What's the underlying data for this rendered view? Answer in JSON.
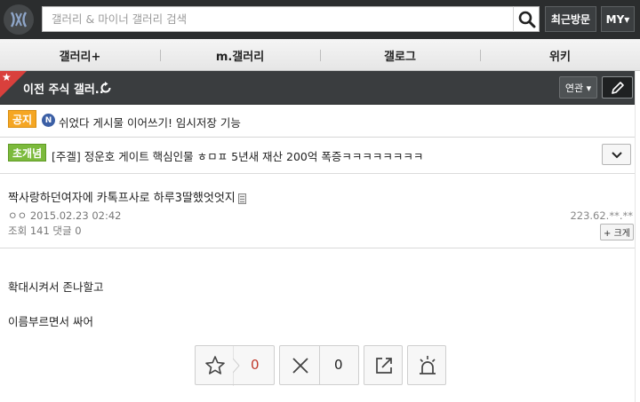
{
  "header": {
    "search_placeholder": "갤러리 & 마이너 갤러리 검색",
    "recent_label": "최근방문",
    "my_label": "MY▾"
  },
  "nav": {
    "items": [
      "갤러리+",
      "m.갤러리",
      "갤로그",
      "위키"
    ]
  },
  "gallery_bar": {
    "title": "이전 주식 갤러..",
    "related_label": "연관 ▾"
  },
  "notice": {
    "badge": "공지",
    "new_mark": "N",
    "text": "쉬었다 게시물 이어쓰기! 임시저장 기능"
  },
  "featured": {
    "badge": "초개념",
    "text": "[주겔] 정운호 게이트 핵심인물 ㅎㅁㅍ 5년새 재산 200억 폭증ㅋㅋㅋㅋㅋㅋㅋㅋ"
  },
  "post": {
    "title": "짝사랑하던여자에 카톡프사로 하루3딸했엇엇지",
    "author_date": "ㅇㅇ 2015.02.23 02:42",
    "ip": "223.62.**.**",
    "stats": "조회 141 댓글 0",
    "zoom_label": "+ 크게",
    "body": [
      "확대시켜서 존나할고",
      "이름부르면서 싸어"
    ]
  },
  "actions": {
    "recommend_count": "0",
    "not_recommend_count": "0"
  },
  "colors": {
    "header_bg": "#2b2d2e",
    "notice_badge": "#f5a623",
    "featured_badge": "#7cba3c",
    "ribbon": "#d9403c",
    "recommend_count": "#c0392b"
  }
}
